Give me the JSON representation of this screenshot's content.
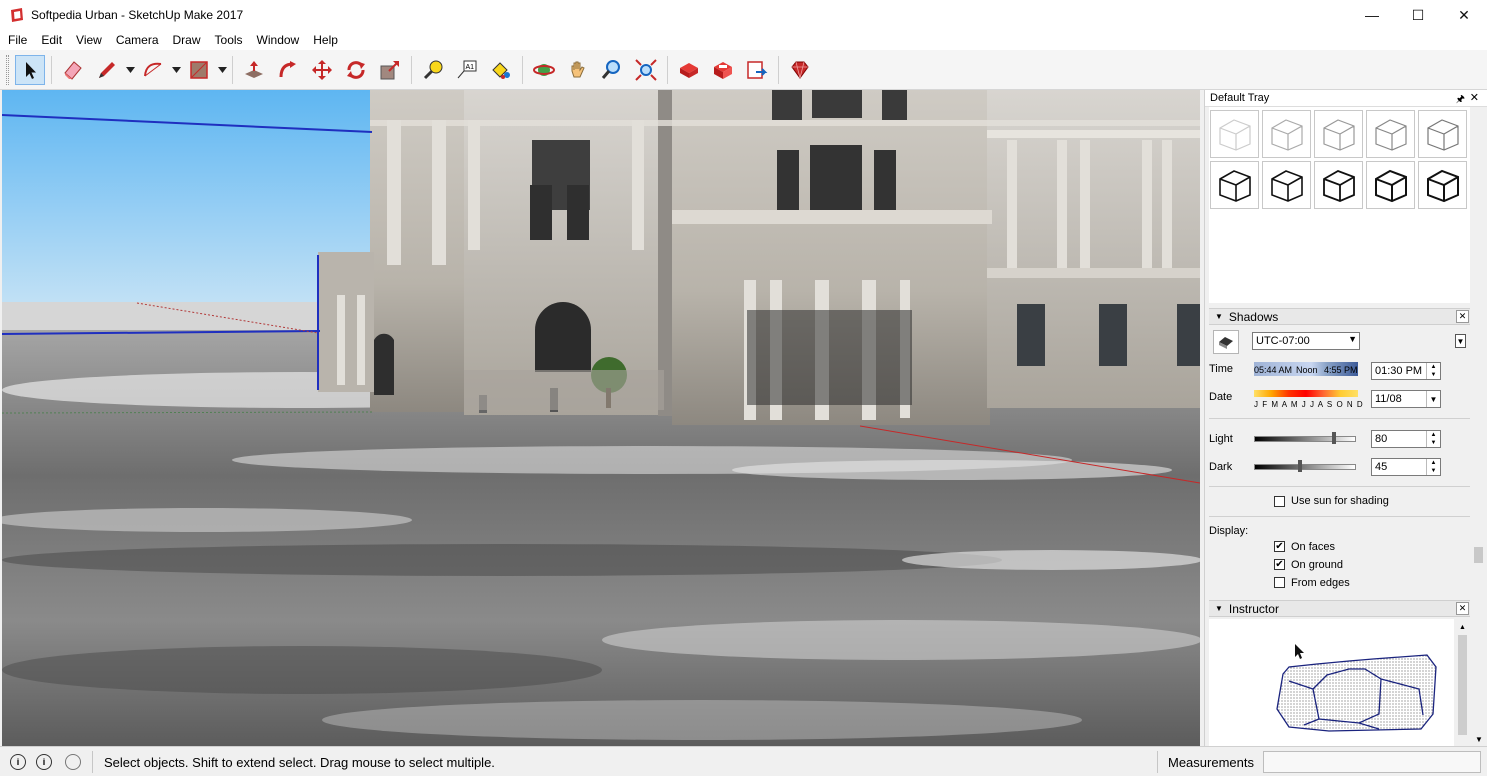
{
  "window": {
    "title": "Softpedia Urban - SketchUp Make 2017",
    "minimize": "—",
    "maximize": "☐",
    "close": "✕"
  },
  "menu": [
    "File",
    "Edit",
    "View",
    "Camera",
    "Draw",
    "Tools",
    "Window",
    "Help"
  ],
  "toolbar": {
    "icons": [
      "select-icon",
      "eraser-icon",
      "pencil-icon",
      "arc-icon",
      "shape-icon",
      "push-pull-icon",
      "follow-me-icon",
      "move-icon",
      "rotate-icon",
      "scale-icon",
      "tape-measure-icon",
      "text-icon",
      "paint-bucket-icon",
      "orbit-icon",
      "pan-icon",
      "zoom-icon",
      "zoom-extents-icon",
      "warehouse-icon",
      "extension-warehouse-icon",
      "layout-icon",
      "extension-manager-icon"
    ]
  },
  "tray": {
    "title": "Default Tray",
    "shadows": {
      "title": "Shadows",
      "timezone": "UTC-07:00",
      "time_label": "Time",
      "time_start": "05:44 AM",
      "time_noon": "Noon",
      "time_end": "4:55 PM",
      "time_value": "01:30 PM",
      "date_label": "Date",
      "months": "J F M A M J J A S O N D",
      "date_value": "11/08",
      "light_label": "Light",
      "light_value": "80",
      "light_level": 0.8,
      "dark_label": "Dark",
      "dark_value": "45",
      "dark_level": 0.45,
      "use_sun_label": "Use sun for shading",
      "use_sun_checked": false,
      "display_label": "Display:",
      "on_faces_label": "On faces",
      "on_faces_checked": true,
      "on_ground_label": "On ground",
      "on_ground_checked": true,
      "from_edges_label": "From edges",
      "from_edges_checked": false
    },
    "instructor": {
      "title": "Instructor"
    }
  },
  "status": {
    "message": "Select objects. Shift to extend select. Drag mouse to select multiple.",
    "measurements_label": "Measurements",
    "measurements_value": ""
  }
}
